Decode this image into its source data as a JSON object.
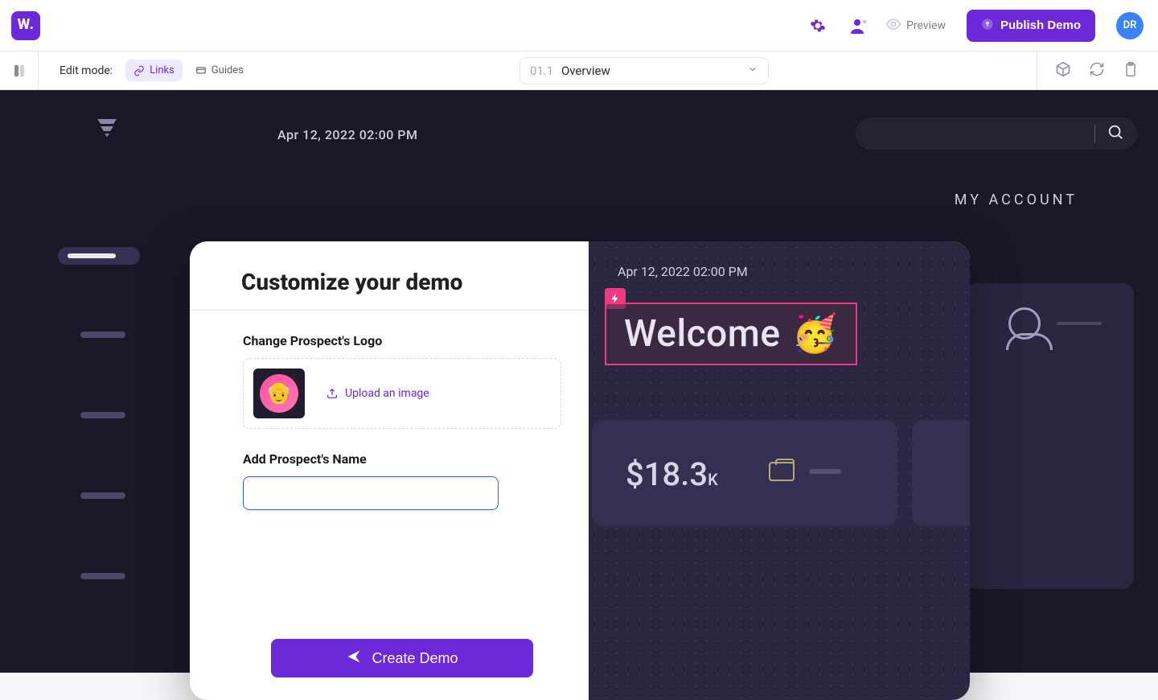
{
  "header": {
    "logo_letter": "W.",
    "preview_label": "Preview",
    "publish_label": "Publish Demo",
    "user_initials": "DR"
  },
  "subbar": {
    "edit_mode_label": "Edit mode:",
    "links_label": "Links",
    "guides_label": "Guides",
    "page_index": "01.1",
    "page_name": "Overview"
  },
  "canvas": {
    "timestamp": "Apr 12, 2022 02:00 PM",
    "my_account": "MY ACCOUNT"
  },
  "modal": {
    "title": "Customize your demo",
    "change_logo_label": "Change Prospect's Logo",
    "upload_label": "Upload an image",
    "add_name_label": "Add Prospect's Name",
    "name_value": "",
    "name_placeholder": "",
    "cta_label": "Create Demo"
  },
  "preview_panel": {
    "timestamp": "Apr 12, 2022 02:00 PM",
    "welcome": "Welcome",
    "welcome_emoji": "🥳",
    "amount_display": "$18.3",
    "amount_suffix": "K"
  },
  "colors": {
    "accent": "#6D28D9",
    "highlight": "#ec3b82",
    "focus": "#2563eb"
  }
}
